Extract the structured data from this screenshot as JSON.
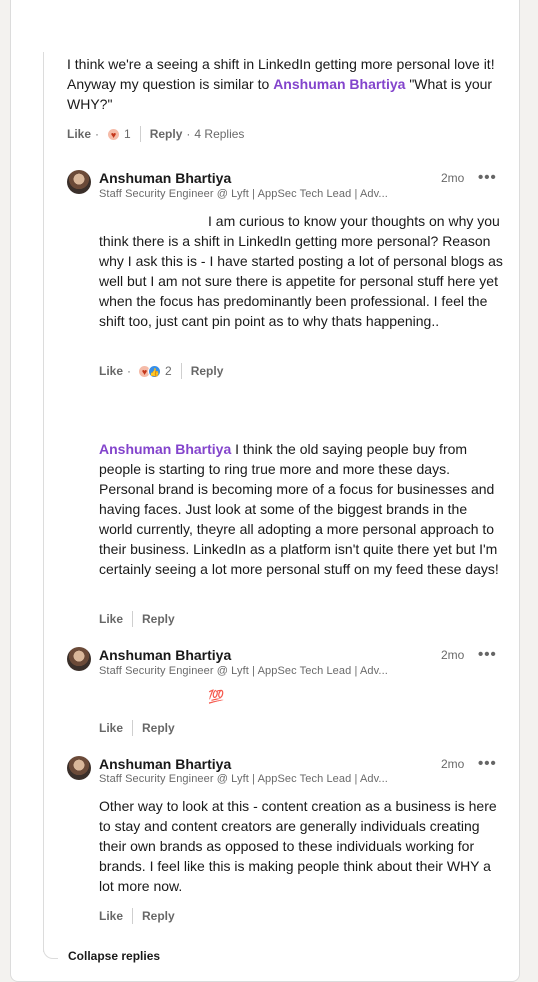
{
  "top_comment": {
    "text_before": "I think we're a seeing a shift in LinkedIn getting more personal love it! Anyway my question is similar to ",
    "mention": "Anshuman Bhartiya",
    "text_after": " \"What is your WHY?\"",
    "actions": {
      "like": "Like",
      "reaction_count": "1",
      "reply": "Reply",
      "replies": "4 Replies"
    }
  },
  "replies": [
    {
      "author": "Anshuman Bhartiya",
      "headline": "Staff Security Engineer @ Lyft | AppSec Tech Lead | Adv...",
      "time": "2mo",
      "text": "I am curious to know your thoughts on why you think there is a shift in LinkedIn getting more personal? Reason why I ask this is - I have started posting a lot of personal blogs as well but I am not sure there is appetite for personal stuff here yet when the focus has predominantly been professional. I feel the shift too, just cant pin point as to why thats happening..",
      "actions": {
        "like": "Like",
        "reaction_count": "2",
        "reply": "Reply"
      }
    },
    {
      "mention": "Anshuman Bhartiya",
      "text": " I think the old saying people buy from people is starting to ring true more and more these days. Personal brand is becoming more of a focus for businesses and having faces. Just look at some of the biggest brands in the world currently, theyre all adopting a more personal approach to their business. LinkedIn as a platform isn't quite there yet but I'm certainly seeing a lot more personal stuff on my feed these days!",
      "actions": {
        "like": "Like",
        "reply": "Reply"
      }
    },
    {
      "author": "Anshuman Bhartiya",
      "headline": "Staff Security Engineer @ Lyft | AppSec Tech Lead | Adv...",
      "time": "2mo",
      "text": "💯",
      "actions": {
        "like": "Like",
        "reply": "Reply"
      }
    },
    {
      "author": "Anshuman Bhartiya",
      "headline": "Staff Security Engineer @ Lyft | AppSec Tech Lead | Adv...",
      "time": "2mo",
      "text": "Other way to look at this - content creation as a business is here to stay and content creators are generally individuals creating their own brands as opposed to these individuals working for brands. I feel like this is making people think about their WHY a lot more now.",
      "actions": {
        "like": "Like",
        "reply": "Reply"
      }
    }
  ],
  "collapse_label": "Collapse replies",
  "more_label": "•••",
  "icons": {
    "more": "more-horizontal-icon",
    "heart": "love-reaction-icon",
    "thumb": "like-reaction-icon"
  },
  "colors": {
    "mention": "#8344cc",
    "like_blue": "#378fe9",
    "love": "#f5bba8"
  }
}
